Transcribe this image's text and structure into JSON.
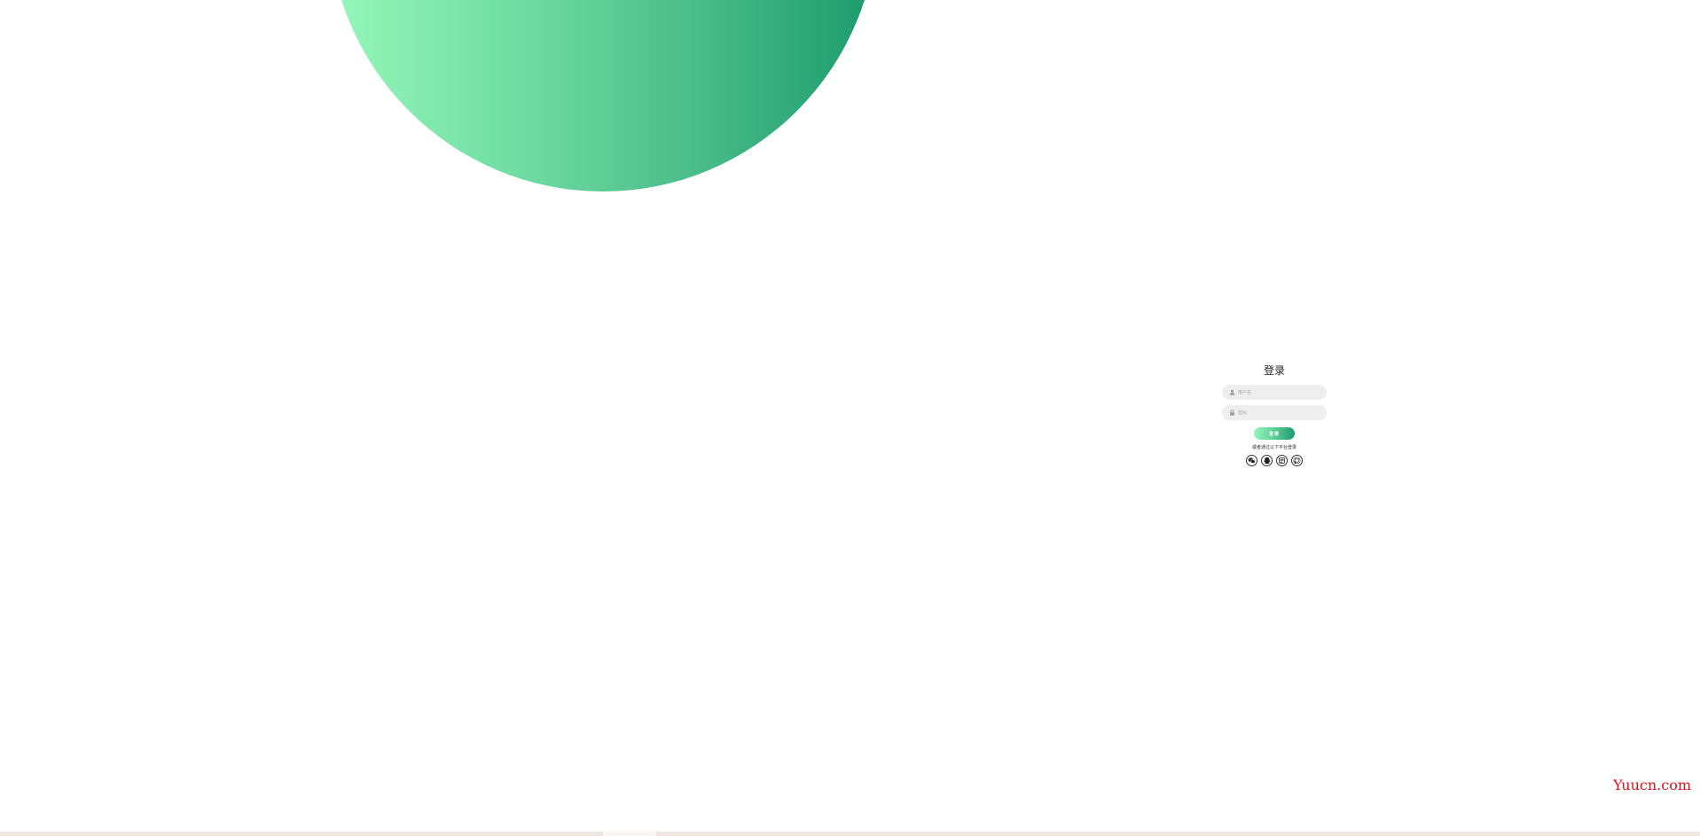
{
  "colors": {
    "gradient_start": "#96f7bb",
    "gradient_end": "#1c9a6d",
    "input_bg": "#eeeeee",
    "watermark": "#e0101c"
  },
  "login": {
    "title": "登录",
    "username": {
      "icon": "user-icon",
      "placeholder": "用户名",
      "value": ""
    },
    "password": {
      "icon": "lock-icon",
      "placeholder": "密码",
      "value": ""
    },
    "submit_label": "登录",
    "social_text": "或者通过以下平台登录",
    "social_icons": [
      "wechat-icon",
      "qq-icon",
      "weibo-icon",
      "github-icon"
    ]
  },
  "watermark": "Yuucn.com"
}
